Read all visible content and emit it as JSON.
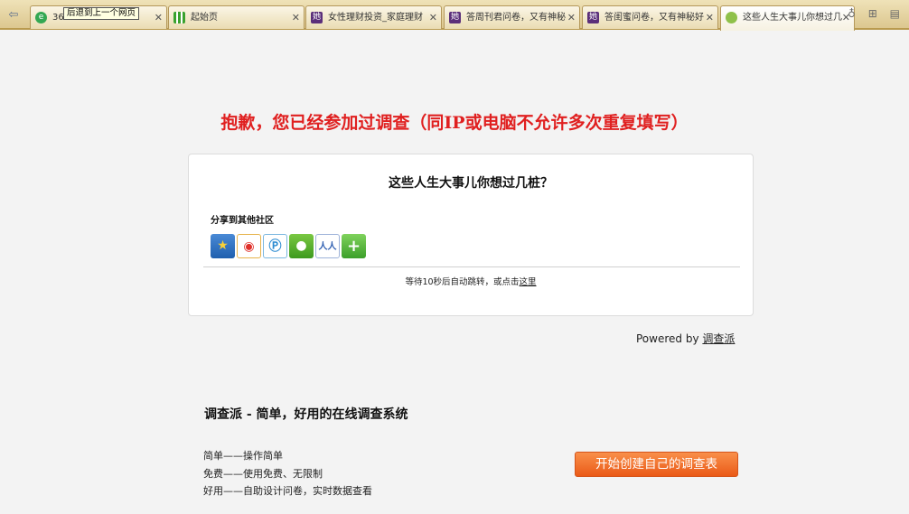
{
  "tabs": [
    {
      "label": "360",
      "icon": "360-browser-icon"
    },
    {
      "label": "起始页",
      "icon": "grid-apps-icon"
    },
    {
      "label": "女性理财投资_家庭理财",
      "icon": "she-logo-icon"
    },
    {
      "label": "答周刊君问卷，又有神秘",
      "icon": "she-logo-icon"
    },
    {
      "label": "答闺蜜问卷，又有神秘好",
      "icon": "she-logo-icon"
    },
    {
      "label": "这些人生大事儿你想过几",
      "icon": "leaf-icon"
    }
  ],
  "tooltip": "后退到上一个网页",
  "alert": "抱歉，您已经参加过调查（同IP或电脑不允许多次重复填写）",
  "survey_title": "这些人生大事儿你想过几桩？",
  "share": {
    "label": "分享到其他社区",
    "buttons": [
      "qzone-icon",
      "weibo-icon",
      "tencent-weibo-icon",
      "wechat-icon",
      "renren-icon",
      "more-plus-icon"
    ]
  },
  "redirect": {
    "text": "等待10秒后自动跳转，或点击",
    "link": "这里"
  },
  "powered": {
    "prefix": "Powered by",
    "link": "调查派"
  },
  "promo": {
    "title": "调查派 - 简单，好用的在线调查系统",
    "features": [
      "简单——操作简单",
      "免费——使用免费、无限制",
      "好用——自助设计问卷，实时数据查看"
    ],
    "cta": "开始创建自己的调查表"
  }
}
